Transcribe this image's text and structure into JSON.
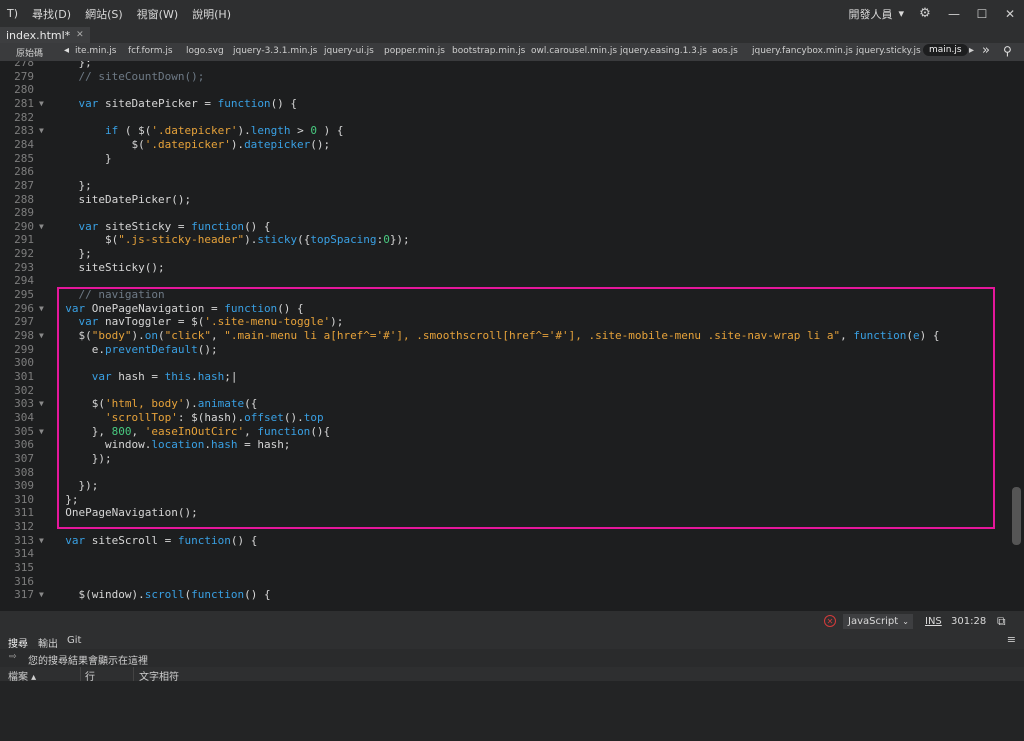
{
  "menubar": {
    "items": [
      "T)",
      "尋找(D)",
      "網站(S)",
      "視窗(W)",
      "說明(H)"
    ],
    "developer_label": "開發人員",
    "developer_caret": "▾",
    "tools_icon": "gear-arrows-icon",
    "minimize_glyph": "—",
    "maximize_glyph": "☐",
    "close_glyph": "✕"
  },
  "doc_tab": {
    "label": "index.html*",
    "close_glyph": "✕"
  },
  "related_files": {
    "source_label": "原始碼",
    "left_arrow": "◂",
    "right_arrow": "▸",
    "more_glyph": "»",
    "filter_glyph": "⚲",
    "files": [
      "ite.min.js",
      "fcf.form.js",
      "logo.svg",
      "jquery-3.3.1.min.js",
      "jquery-ui.js",
      "popper.min.js",
      "bootstrap.min.js",
      "owl.carousel.min.js",
      "jquery.easing.1.3.js",
      "aos.js",
      "jquery.fancybox.min.js",
      "jquery.sticky.js",
      "main.js"
    ],
    "active_file": "main.js"
  },
  "editor": {
    "lines": [
      {
        "n": "278",
        "fold": "",
        "tokens": [
          [
            "pl",
            "    };"
          ]
        ]
      },
      {
        "n": "279",
        "fold": "",
        "tokens": [
          [
            "com",
            "    // siteCountDown();"
          ]
        ]
      },
      {
        "n": "280",
        "fold": "",
        "tokens": [
          [
            "pl",
            ""
          ]
        ]
      },
      {
        "n": "281",
        "fold": "▼",
        "tokens": [
          [
            "kw",
            "    var "
          ],
          [
            "pl",
            "siteDatePicker = "
          ],
          [
            "kw",
            "function"
          ],
          [
            "pl",
            "() {"
          ]
        ]
      },
      {
        "n": "282",
        "fold": "",
        "tokens": [
          [
            "pl",
            ""
          ]
        ]
      },
      {
        "n": "283",
        "fold": "▼",
        "tokens": [
          [
            "kw",
            "        if "
          ],
          [
            "pl",
            "( $("
          ],
          [
            "str",
            "'.datepicker'"
          ],
          [
            "pl",
            ")."
          ],
          [
            "fn",
            "length"
          ],
          [
            "pl",
            " > "
          ],
          [
            "num",
            "0"
          ],
          [
            "pl",
            " ) {"
          ]
        ]
      },
      {
        "n": "284",
        "fold": "",
        "tokens": [
          [
            "pl",
            "            $("
          ],
          [
            "str",
            "'.datepicker'"
          ],
          [
            "pl",
            ")."
          ],
          [
            "fn",
            "datepicker"
          ],
          [
            "pl",
            "();"
          ]
        ]
      },
      {
        "n": "285",
        "fold": "",
        "tokens": [
          [
            "pl",
            "        }"
          ]
        ]
      },
      {
        "n": "286",
        "fold": "",
        "tokens": [
          [
            "pl",
            ""
          ]
        ]
      },
      {
        "n": "287",
        "fold": "",
        "tokens": [
          [
            "pl",
            "    };"
          ]
        ]
      },
      {
        "n": "288",
        "fold": "",
        "tokens": [
          [
            "pl",
            "    siteDatePicker();"
          ]
        ]
      },
      {
        "n": "289",
        "fold": "",
        "tokens": [
          [
            "pl",
            ""
          ]
        ]
      },
      {
        "n": "290",
        "fold": "▼",
        "tokens": [
          [
            "kw",
            "    var "
          ],
          [
            "pl",
            "siteSticky = "
          ],
          [
            "kw",
            "function"
          ],
          [
            "pl",
            "() {"
          ]
        ]
      },
      {
        "n": "291",
        "fold": "",
        "tokens": [
          [
            "pl",
            "        $("
          ],
          [
            "str",
            "\".js-sticky-header\""
          ],
          [
            "pl",
            ")."
          ],
          [
            "fn",
            "sticky"
          ],
          [
            "pl",
            "({"
          ],
          [
            "fn",
            "topSpacing"
          ],
          [
            "pl",
            ":"
          ],
          [
            "num",
            "0"
          ],
          [
            "pl",
            "});"
          ]
        ]
      },
      {
        "n": "292",
        "fold": "",
        "tokens": [
          [
            "pl",
            "    };"
          ]
        ]
      },
      {
        "n": "293",
        "fold": "",
        "tokens": [
          [
            "pl",
            "    siteSticky();"
          ]
        ]
      },
      {
        "n": "294",
        "fold": "",
        "tokens": [
          [
            "pl",
            ""
          ]
        ]
      },
      {
        "n": "295",
        "fold": "",
        "tokens": [
          [
            "com",
            "    // navigation"
          ]
        ]
      },
      {
        "n": "296",
        "fold": "▼",
        "tokens": [
          [
            "kw",
            "  var "
          ],
          [
            "pl",
            "OnePageNavigation = "
          ],
          [
            "kw",
            "function"
          ],
          [
            "pl",
            "() {"
          ]
        ]
      },
      {
        "n": "297",
        "fold": "",
        "tokens": [
          [
            "kw",
            "    var "
          ],
          [
            "pl",
            "navToggler = $("
          ],
          [
            "str",
            "'.site-menu-toggle'"
          ],
          [
            "pl",
            ");"
          ]
        ]
      },
      {
        "n": "298",
        "fold": "▼",
        "tokens": [
          [
            "pl",
            "    $("
          ],
          [
            "str",
            "\"body\""
          ],
          [
            "pl",
            ")."
          ],
          [
            "fn",
            "on"
          ],
          [
            "pl",
            "("
          ],
          [
            "str",
            "\"click\""
          ],
          [
            "pl",
            ", "
          ],
          [
            "str",
            "\".main-menu li a[href^='#'], .smoothscroll[href^='#'], .site-mobile-menu .site-nav-wrap li a\""
          ],
          [
            "pl",
            ", "
          ],
          [
            "kw",
            "function"
          ],
          [
            "pl",
            "("
          ],
          [
            "fn",
            "e"
          ],
          [
            "pl",
            ") {"
          ]
        ]
      },
      {
        "n": "299",
        "fold": "",
        "tokens": [
          [
            "pl",
            "      e."
          ],
          [
            "fn",
            "preventDefault"
          ],
          [
            "pl",
            "();"
          ]
        ]
      },
      {
        "n": "300",
        "fold": "",
        "tokens": [
          [
            "pl",
            ""
          ]
        ]
      },
      {
        "n": "301",
        "fold": "",
        "tokens": [
          [
            "kw",
            "      var "
          ],
          [
            "pl",
            "hash = "
          ],
          [
            "kw",
            "this"
          ],
          [
            "pl",
            "."
          ],
          [
            "fn",
            "hash"
          ],
          [
            "pl",
            ";|"
          ]
        ]
      },
      {
        "n": "302",
        "fold": "",
        "tokens": [
          [
            "pl",
            ""
          ]
        ]
      },
      {
        "n": "303",
        "fold": "▼",
        "tokens": [
          [
            "pl",
            "      $("
          ],
          [
            "str",
            "'html, body'"
          ],
          [
            "pl",
            ")."
          ],
          [
            "fn",
            "animate"
          ],
          [
            "pl",
            "({"
          ]
        ]
      },
      {
        "n": "304",
        "fold": "",
        "tokens": [
          [
            "str",
            "        'scrollTop'"
          ],
          [
            "pl",
            ": $(hash)."
          ],
          [
            "fn",
            "offset"
          ],
          [
            "pl",
            "()."
          ],
          [
            "fn",
            "top"
          ]
        ]
      },
      {
        "n": "305",
        "fold": "▼",
        "tokens": [
          [
            "pl",
            "      }, "
          ],
          [
            "num",
            "800"
          ],
          [
            "pl",
            ", "
          ],
          [
            "str",
            "'easeInOutCirc'"
          ],
          [
            "pl",
            ", "
          ],
          [
            "kw",
            "function"
          ],
          [
            "pl",
            "(){"
          ]
        ]
      },
      {
        "n": "306",
        "fold": "",
        "tokens": [
          [
            "pl",
            "        window."
          ],
          [
            "fn",
            "location"
          ],
          [
            "pl",
            "."
          ],
          [
            "fn",
            "hash"
          ],
          [
            "pl",
            " = hash;"
          ]
        ]
      },
      {
        "n": "307",
        "fold": "",
        "tokens": [
          [
            "pl",
            "      });"
          ]
        ]
      },
      {
        "n": "308",
        "fold": "",
        "tokens": [
          [
            "pl",
            ""
          ]
        ]
      },
      {
        "n": "309",
        "fold": "",
        "tokens": [
          [
            "pl",
            "    });"
          ]
        ]
      },
      {
        "n": "310",
        "fold": "",
        "tokens": [
          [
            "pl",
            "  };"
          ]
        ]
      },
      {
        "n": "311",
        "fold": "",
        "tokens": [
          [
            "pl",
            "  OnePageNavigation();"
          ]
        ]
      },
      {
        "n": "312",
        "fold": "",
        "tokens": [
          [
            "pl",
            ""
          ]
        ]
      },
      {
        "n": "313",
        "fold": "▼",
        "tokens": [
          [
            "kw",
            "  var "
          ],
          [
            "pl",
            "siteScroll = "
          ],
          [
            "kw",
            "function"
          ],
          [
            "pl",
            "() {"
          ]
        ]
      },
      {
        "n": "314",
        "fold": "",
        "tokens": [
          [
            "pl",
            ""
          ]
        ]
      },
      {
        "n": "315",
        "fold": "",
        "tokens": [
          [
            "pl",
            ""
          ]
        ]
      },
      {
        "n": "316",
        "fold": "",
        "tokens": [
          [
            "pl",
            ""
          ]
        ]
      },
      {
        "n": "317",
        "fold": "▼",
        "tokens": [
          [
            "pl",
            "    $(window)."
          ],
          [
            "fn",
            "scroll"
          ],
          [
            "pl",
            "("
          ],
          [
            "kw",
            "function"
          ],
          [
            "pl",
            "() {"
          ]
        ]
      }
    ]
  },
  "statusbar": {
    "error_glyph": "✕",
    "language": "JavaScript",
    "language_caret": "⌄",
    "ins_label": "INS",
    "cursor_position": "301:28",
    "preview_glyph": "⧉"
  },
  "panel": {
    "tabs": [
      "搜尋",
      "輸出",
      "Git"
    ],
    "menu_glyph": "≡",
    "message_icon": "⇨",
    "message": "您的搜尋結果會顯示在這裡",
    "columns": [
      "檔案 ▴",
      "行",
      "文字相符"
    ]
  },
  "colors": {
    "accent_highlight": "#e5179b",
    "keyword": "#39a0e3",
    "string": "#e6a23a",
    "number": "#48c97f",
    "comment": "#6e7a86"
  }
}
